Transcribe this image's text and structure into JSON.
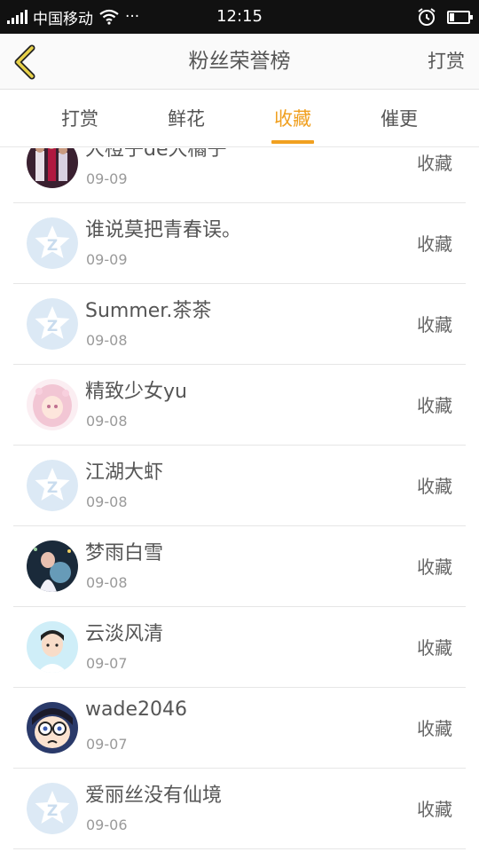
{
  "status_bar": {
    "carrier": "中国移动",
    "more": "···",
    "time": "12:15"
  },
  "header": {
    "title": "粉丝荣誉榜",
    "action": "打赏"
  },
  "tabs": [
    {
      "label": "打赏",
      "active": false
    },
    {
      "label": "鲜花",
      "active": false
    },
    {
      "label": "收藏",
      "active": true
    },
    {
      "label": "催更",
      "active": false
    }
  ],
  "accent_color": "#f0a020",
  "list": [
    {
      "name": "大橙子de大橘子",
      "date": "09-09",
      "label": "收藏",
      "avatar": "photo-avatar-icon"
    },
    {
      "name": "谁说莫把青春误。",
      "date": "09-09",
      "label": "收藏",
      "avatar": "default-avatar-icon"
    },
    {
      "name": "Summer.茶茶",
      "date": "09-08",
      "label": "收藏",
      "avatar": "default-avatar-icon"
    },
    {
      "name": "精致少女yu",
      "date": "09-08",
      "label": "收藏",
      "avatar": "anime-girl-avatar-icon"
    },
    {
      "name": "江湖大虾",
      "date": "09-08",
      "label": "收藏",
      "avatar": "default-avatar-icon"
    },
    {
      "name": "梦雨白雪",
      "date": "09-08",
      "label": "收藏",
      "avatar": "fantasy-avatar-icon"
    },
    {
      "name": "云淡风清",
      "date": "09-07",
      "label": "收藏",
      "avatar": "boy-avatar-icon"
    },
    {
      "name": "wade2046",
      "date": "09-07",
      "label": "收藏",
      "avatar": "conan-avatar-icon"
    },
    {
      "name": "爱丽丝没有仙境",
      "date": "09-06",
      "label": "收藏",
      "avatar": "default-avatar-icon"
    }
  ]
}
